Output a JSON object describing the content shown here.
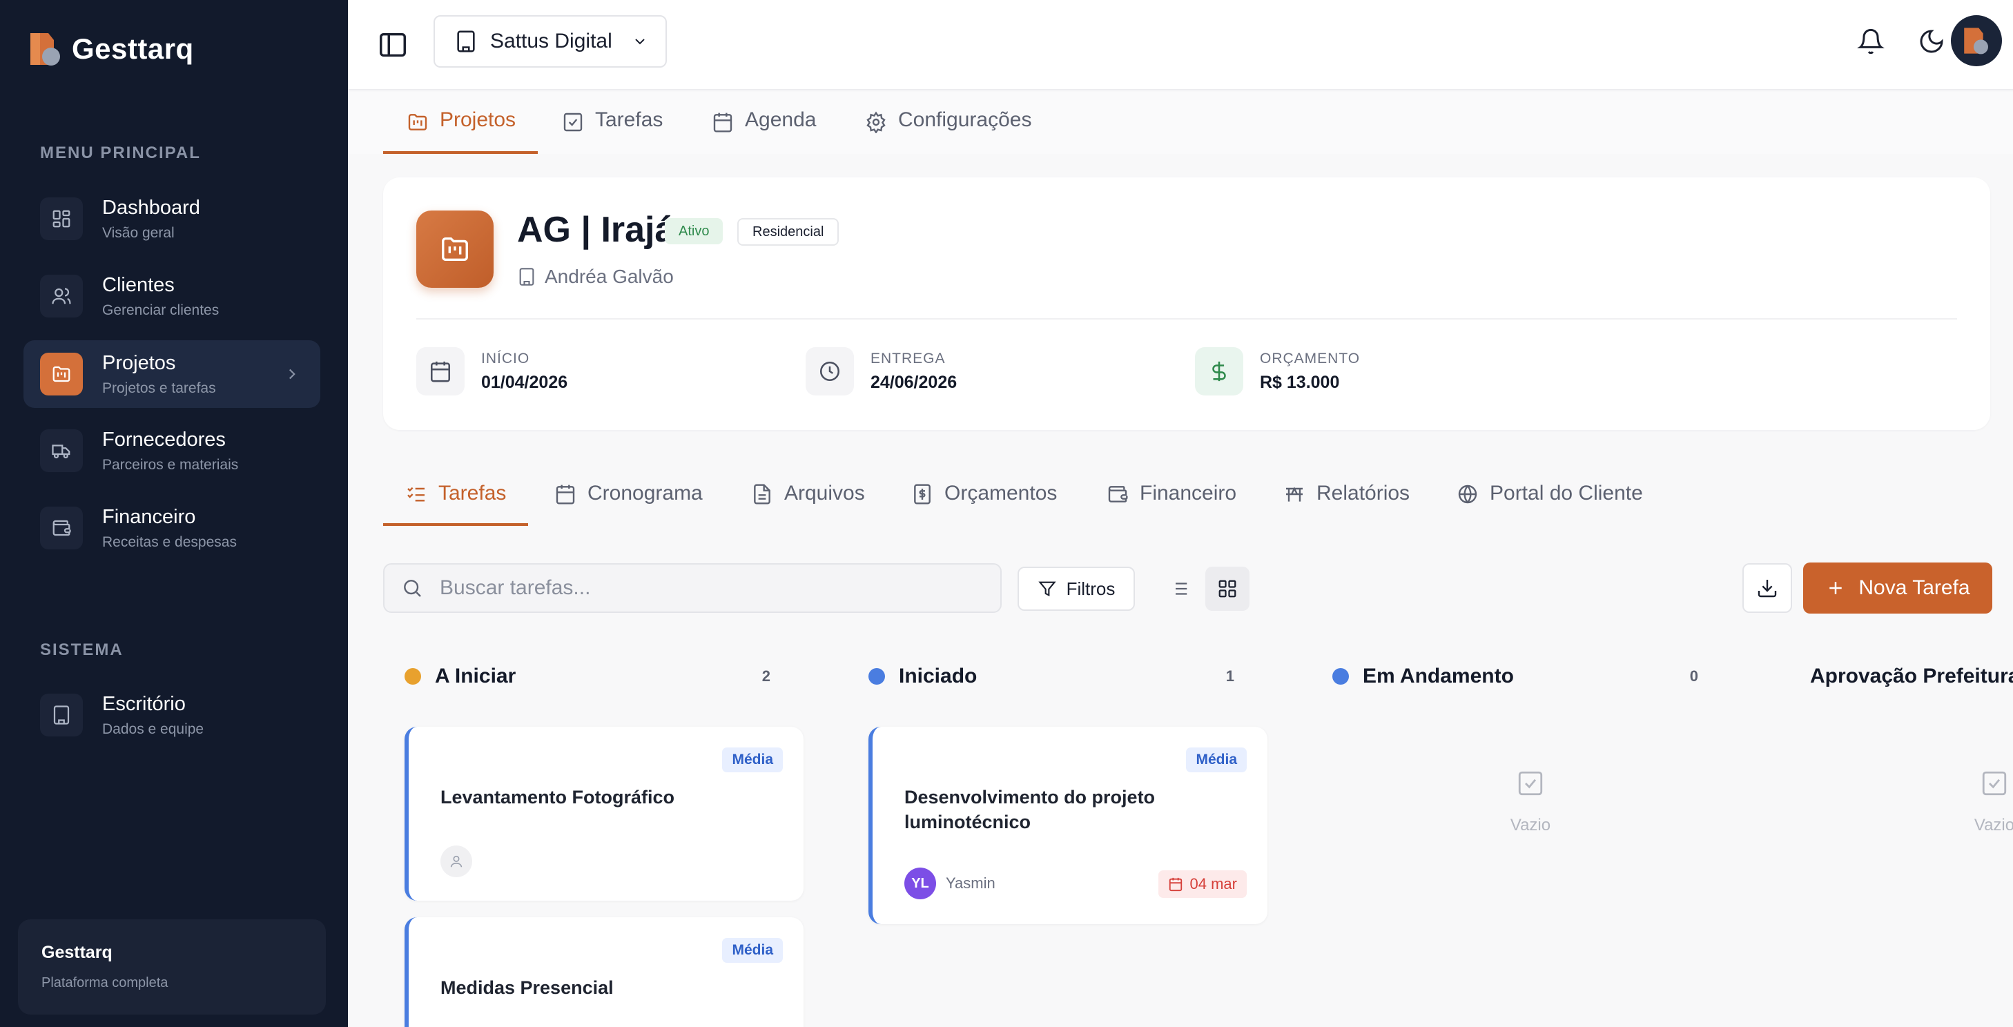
{
  "brand": {
    "name": "Gesttarq"
  },
  "sidebar": {
    "section_main": "MENU PRINCIPAL",
    "section_system": "SISTEMA",
    "items": [
      {
        "title": "Dashboard",
        "sub": "Visão geral",
        "icon": "dashboard-icon"
      },
      {
        "title": "Clientes",
        "sub": "Gerenciar clientes",
        "icon": "users-icon"
      },
      {
        "title": "Projetos",
        "sub": "Projetos e tarefas",
        "icon": "folder-kanban-icon",
        "active": true
      },
      {
        "title": "Fornecedores",
        "sub": "Parceiros e materiais",
        "icon": "truck-icon"
      },
      {
        "title": "Financeiro",
        "sub": "Receitas e despesas",
        "icon": "wallet-icon"
      }
    ],
    "system_items": [
      {
        "title": "Escritório",
        "sub": "Dados e equipe",
        "icon": "building-icon"
      }
    ],
    "footer": {
      "title": "Gesttarq",
      "sub": "Plataforma completa"
    }
  },
  "topbar": {
    "org_name": "Sattus Digital"
  },
  "section_tabs": [
    {
      "label": "Projetos",
      "active": true
    },
    {
      "label": "Tarefas"
    },
    {
      "label": "Agenda"
    },
    {
      "label": "Configurações"
    }
  ],
  "project": {
    "title": "AG | Irajá",
    "status": "Ativo",
    "type": "Residencial",
    "client": "Andréa Galvão",
    "start_label": "INÍCIO",
    "start_value": "01/04/2026",
    "delivery_label": "ENTREGA",
    "delivery_value": "24/06/2026",
    "budget_label": "ORÇAMENTO",
    "budget_value": "R$ 13.000"
  },
  "project_tabs": [
    {
      "label": "Tarefas",
      "active": true
    },
    {
      "label": "Cronograma"
    },
    {
      "label": "Arquivos"
    },
    {
      "label": "Orçamentos"
    },
    {
      "label": "Financeiro"
    },
    {
      "label": "Relatórios"
    },
    {
      "label": "Portal do Cliente"
    }
  ],
  "toolbar": {
    "search_placeholder": "Buscar tarefas...",
    "filters_label": "Filtros",
    "new_task_label": "Nova Tarefa"
  },
  "kanban": {
    "columns": [
      {
        "title": "A Iniciar",
        "count": "2",
        "color": "#e8a12e"
      },
      {
        "title": "Iniciado",
        "count": "1",
        "color": "#4a7de0"
      },
      {
        "title": "Em Andamento",
        "count": "0",
        "color": "#4a7de0",
        "empty_text": "Vazio"
      },
      {
        "title": "Aprovação Prefeitura",
        "color": "#8b5cf0",
        "empty_text": "Vazio"
      }
    ],
    "cards": [
      {
        "priority": "Média",
        "title": "Levantamento Fotográfico"
      },
      {
        "priority": "Média",
        "title": "Medidas Presencial"
      },
      {
        "priority": "Média",
        "title": "Desenvolvimento do projeto luminotécnico",
        "assignee_initials": "YL",
        "assignee_name": "Yasmin",
        "due": "04 mar"
      }
    ]
  },
  "colors": {
    "accent": "#c9622c",
    "sidebar_bg": "#121a2c"
  }
}
